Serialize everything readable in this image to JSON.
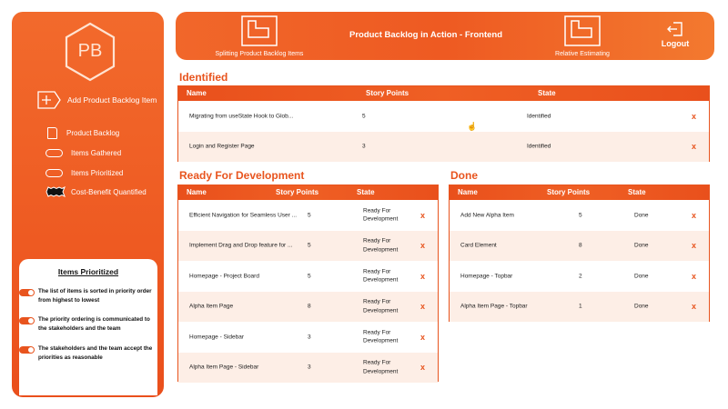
{
  "sidebar": {
    "logo_text": "PB",
    "add_item_label": "Add Product Backlog Item",
    "nav": [
      {
        "label": "Product Backlog",
        "icon": "document-icon"
      },
      {
        "label": "Items Gathered",
        "icon": "pill-icon"
      },
      {
        "label": "Items Prioritized",
        "icon": "pill-icon"
      },
      {
        "label": "Cost-Benefit Quantified",
        "icon": "wavy-badge-icon"
      }
    ],
    "panel": {
      "title": "Items Prioritized",
      "criteria": [
        "The list of items is sorted in priority order from highest to lowest",
        "The priority ordering is communicated to the stakeholders and the team",
        "The stakeholders and the team accept the priorities as reasonable"
      ]
    }
  },
  "header": {
    "left_tool": "Splitting Product Backlog Items",
    "title": "Product Backlog in Action - Frontend",
    "right_tool": "Relative Estimating",
    "logout": "Logout"
  },
  "sections": {
    "identified": {
      "title": "Identified",
      "columns": [
        "Name",
        "Story Points",
        "State"
      ],
      "rows": [
        {
          "name": "Migrating from useState Hook to Glob...",
          "points": "5",
          "state": "Identified"
        },
        {
          "name": "Login and Register Page",
          "points": "3",
          "state": "Identified"
        }
      ]
    },
    "ready": {
      "title": "Ready For Development",
      "columns": [
        "Name",
        "Story Points",
        "State"
      ],
      "rows": [
        {
          "name": "Efficient Navigation for Seamless User ...",
          "points": "5",
          "state": "Ready For Development"
        },
        {
          "name": "Implement Drag and Drop feature for ...",
          "points": "5",
          "state": "Ready For Development"
        },
        {
          "name": "Homepage - Project Board",
          "points": "5",
          "state": "Ready For Development"
        },
        {
          "name": "Alpha Item Page",
          "points": "8",
          "state": "Ready For Development"
        },
        {
          "name": "Homepage - Sidebar",
          "points": "3",
          "state": "Ready For Development"
        },
        {
          "name": "Alpha Item Page - Sidebar",
          "points": "3",
          "state": "Ready For Development"
        }
      ]
    },
    "done": {
      "title": "Done",
      "columns": [
        "Name",
        "Story Points",
        "State"
      ],
      "rows": [
        {
          "name": "Add New Alpha Item",
          "points": "5",
          "state": "Done"
        },
        {
          "name": "Card Element",
          "points": "8",
          "state": "Done"
        },
        {
          "name": "Homepage - Topbar",
          "points": "2",
          "state": "Done"
        },
        {
          "name": "Alpha Item Page - Topbar",
          "points": "1",
          "state": "Done"
        }
      ]
    }
  },
  "delete_glyph": "x",
  "colors": {
    "accent": "#e8541e",
    "row_alt": "#fdeee6"
  }
}
